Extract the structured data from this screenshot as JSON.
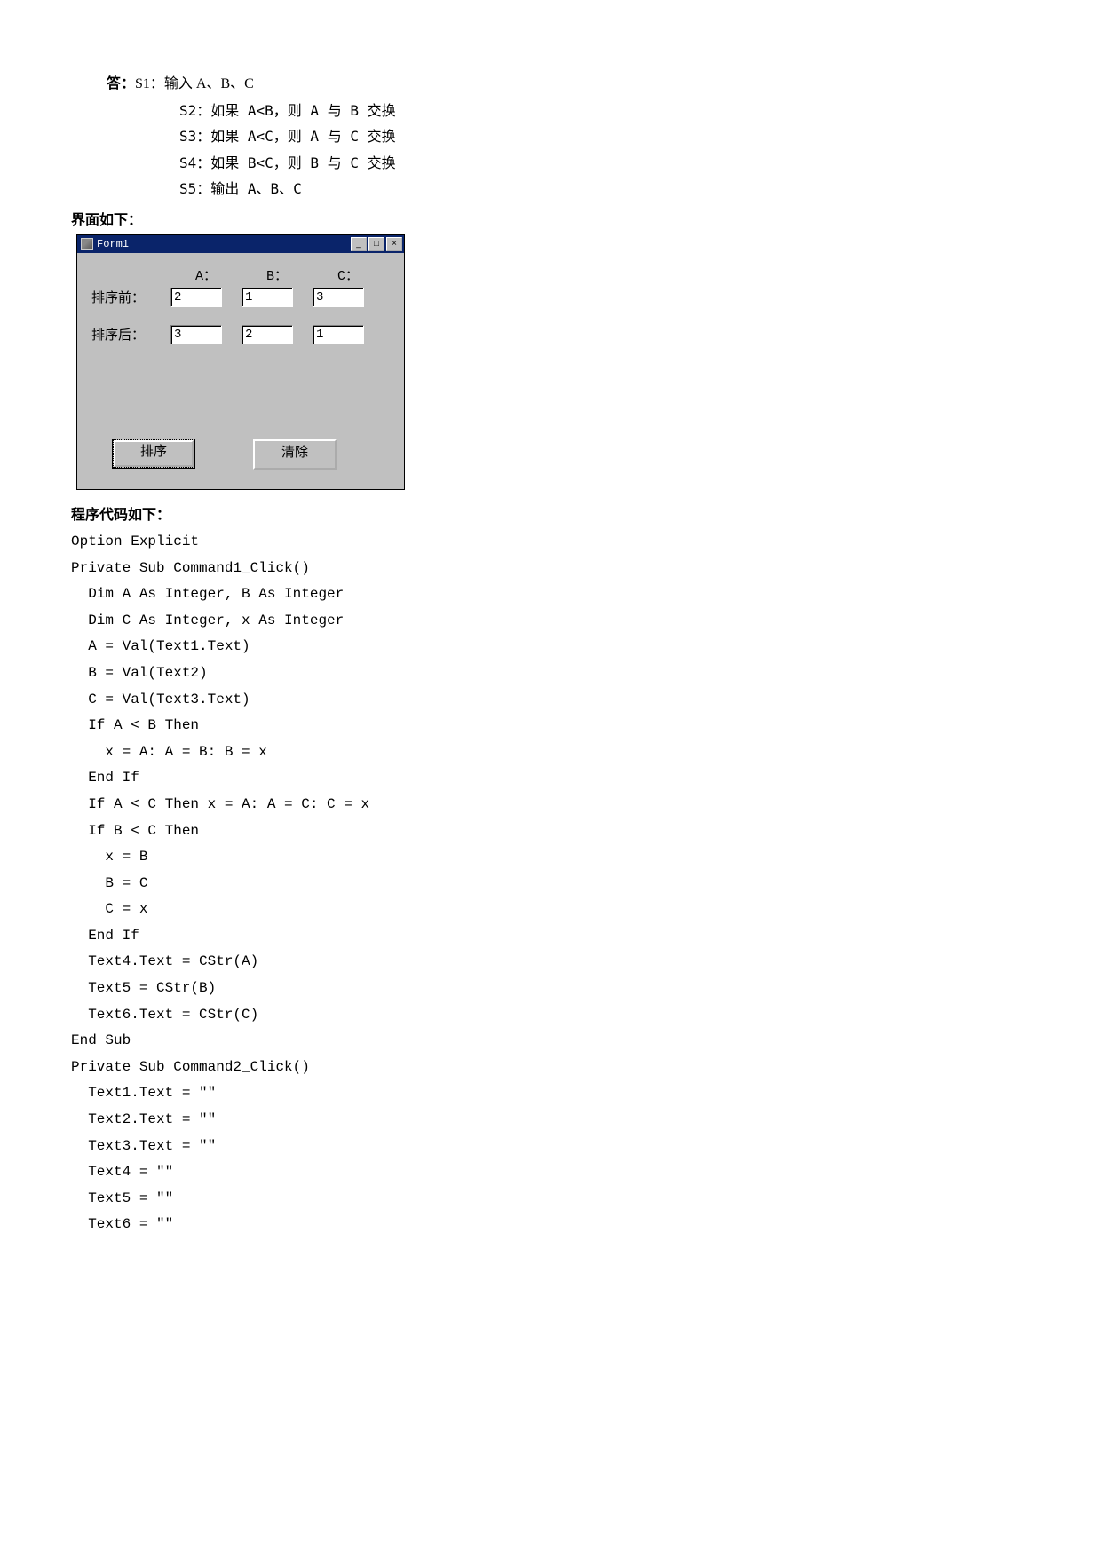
{
  "answer": {
    "label": "答：",
    "s1": "S1：输入 A、B、C",
    "s2": "S2：如果 A<B，则 A 与 B 交换",
    "s3": "S3：如果 A<C，则 A 与 C 交换",
    "s4": "S4：如果 B<C，则 B 与 C 交换",
    "s5": "S5：输出 A、B、C"
  },
  "ui_heading": "界面如下：",
  "form": {
    "title": "Form1",
    "col_a": "A：",
    "col_b": "B：",
    "col_c": "C：",
    "row1_label": "排序前：",
    "row2_label": "排序后：",
    "t1": "2",
    "t2": "1",
    "t3": "3",
    "t4": "3",
    "t5": "2",
    "t6": "1",
    "btn_sort": "排序",
    "btn_clear": "清除",
    "win_min": "_",
    "win_max": "□",
    "win_close": "×"
  },
  "code_heading": "程序代码如下：",
  "code": "Option Explicit\nPrivate Sub Command1_Click()\n  Dim A As Integer, B As Integer\n  Dim C As Integer, x As Integer\n  A = Val(Text1.Text)\n  B = Val(Text2)\n  C = Val(Text3.Text)\n  If A < B Then\n    x = A: A = B: B = x\n  End If\n  If A < C Then x = A: A = C: C = x\n  If B < C Then\n    x = B\n    B = C\n    C = x\n  End If\n  Text4.Text = CStr(A)\n  Text5 = CStr(B)\n  Text6.Text = CStr(C)\nEnd Sub\nPrivate Sub Command2_Click()\n  Text1.Text = \"\"\n  Text2.Text = \"\"\n  Text3.Text = \"\"\n  Text4 = \"\"\n  Text5 = \"\"\n  Text6 = \"\""
}
